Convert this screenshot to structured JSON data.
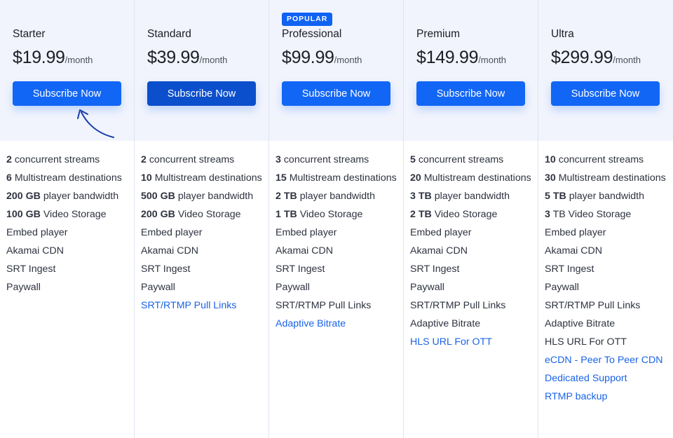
{
  "plans": [
    {
      "name": "Starter",
      "price": "$19.99",
      "unit": "/month",
      "cta": "Subscribe Now",
      "badge": "",
      "features": [
        {
          "strong": "2",
          "text": " concurrent streams",
          "link": false
        },
        {
          "strong": "6",
          "text": " Multistream destinations",
          "link": false
        },
        {
          "strong": "200 GB",
          "text": " player bandwidth",
          "link": false
        },
        {
          "strong": "100 GB",
          "text": " Video Storage",
          "link": false
        },
        {
          "strong": "",
          "text": "Embed player",
          "link": false
        },
        {
          "strong": "",
          "text": "Akamai CDN",
          "link": false
        },
        {
          "strong": "",
          "text": "SRT Ingest",
          "link": false
        },
        {
          "strong": "",
          "text": "Paywall",
          "link": false
        }
      ]
    },
    {
      "name": "Standard",
      "price": "$39.99",
      "unit": "/month",
      "cta": "Subscribe Now",
      "badge": "",
      "features": [
        {
          "strong": "2",
          "text": " concurrent streams",
          "link": false
        },
        {
          "strong": "10",
          "text": " Multistream destinations",
          "link": false
        },
        {
          "strong": "500 GB",
          "text": " player bandwidth",
          "link": false
        },
        {
          "strong": "200 GB",
          "text": " Video Storage",
          "link": false
        },
        {
          "strong": "",
          "text": "Embed player",
          "link": false
        },
        {
          "strong": "",
          "text": "Akamai CDN",
          "link": false
        },
        {
          "strong": "",
          "text": "SRT Ingest",
          "link": false
        },
        {
          "strong": "",
          "text": "Paywall",
          "link": false
        },
        {
          "strong": "",
          "text": "SRT/RTMP Pull Links",
          "link": true
        }
      ]
    },
    {
      "name": "Professional",
      "price": "$99.99",
      "unit": "/month",
      "cta": "Subscribe Now",
      "badge": "POPULAR",
      "features": [
        {
          "strong": "3",
          "text": " concurrent streams",
          "link": false
        },
        {
          "strong": "15",
          "text": " Multistream destinations",
          "link": false
        },
        {
          "strong": "2 TB",
          "text": " player bandwidth",
          "link": false
        },
        {
          "strong": "1 TB",
          "text": " Video Storage",
          "link": false
        },
        {
          "strong": "",
          "text": "Embed player",
          "link": false
        },
        {
          "strong": "",
          "text": "Akamai CDN",
          "link": false
        },
        {
          "strong": "",
          "text": "SRT Ingest",
          "link": false
        },
        {
          "strong": "",
          "text": "Paywall",
          "link": false
        },
        {
          "strong": "",
          "text": "SRT/RTMP Pull Links",
          "link": false
        },
        {
          "strong": "",
          "text": "Adaptive Bitrate",
          "link": true
        }
      ]
    },
    {
      "name": "Premium",
      "price": "$149.99",
      "unit": "/month",
      "cta": "Subscribe Now",
      "badge": "",
      "features": [
        {
          "strong": "5",
          "text": " concurrent streams",
          "link": false
        },
        {
          "strong": "20",
          "text": " Multistream destinations",
          "link": false
        },
        {
          "strong": "3 TB",
          "text": " player bandwidth",
          "link": false
        },
        {
          "strong": "2 TB",
          "text": " Video Storage",
          "link": false
        },
        {
          "strong": "",
          "text": "Embed player",
          "link": false
        },
        {
          "strong": "",
          "text": "Akamai CDN",
          "link": false
        },
        {
          "strong": "",
          "text": "SRT Ingest",
          "link": false
        },
        {
          "strong": "",
          "text": "Paywall",
          "link": false
        },
        {
          "strong": "",
          "text": "SRT/RTMP Pull Links",
          "link": false
        },
        {
          "strong": "",
          "text": "Adaptive Bitrate",
          "link": false
        },
        {
          "strong": "",
          "text": "HLS URL For OTT",
          "link": true
        }
      ]
    },
    {
      "name": "Ultra",
      "price": "$299.99",
      "unit": "/month",
      "cta": "Subscribe Now",
      "badge": "",
      "features": [
        {
          "strong": "10",
          "text": " concurrent streams",
          "link": false
        },
        {
          "strong": "30",
          "text": " Multistream destinations",
          "link": false
        },
        {
          "strong": "5 TB",
          "text": " player bandwidth",
          "link": false
        },
        {
          "strong": "3",
          "text": " TB Video Storage",
          "link": false
        },
        {
          "strong": "",
          "text": "Embed player",
          "link": false
        },
        {
          "strong": "",
          "text": "Akamai CDN",
          "link": false
        },
        {
          "strong": "",
          "text": "SRT Ingest",
          "link": false
        },
        {
          "strong": "",
          "text": "Paywall",
          "link": false
        },
        {
          "strong": "",
          "text": "SRT/RTMP Pull Links",
          "link": false
        },
        {
          "strong": "",
          "text": "Adaptive Bitrate",
          "link": false
        },
        {
          "strong": "",
          "text": "HLS URL For OTT",
          "link": false
        },
        {
          "strong": "",
          "text": "eCDN - Peer To Peer CDN",
          "link": true
        },
        {
          "strong": "",
          "text": "Dedicated Support",
          "link": true
        },
        {
          "strong": "",
          "text": "RTMP backup",
          "link": true
        }
      ]
    }
  ],
  "hovered_plan": "Standard",
  "colors": {
    "accent": "#1266f5",
    "accent_hover": "#0c4fcc",
    "link": "#1a63e8",
    "header_bg": "#f1f4fc",
    "divider": "#dfe4f0"
  },
  "icons": {
    "pointer": "curved-arrow-icon"
  }
}
